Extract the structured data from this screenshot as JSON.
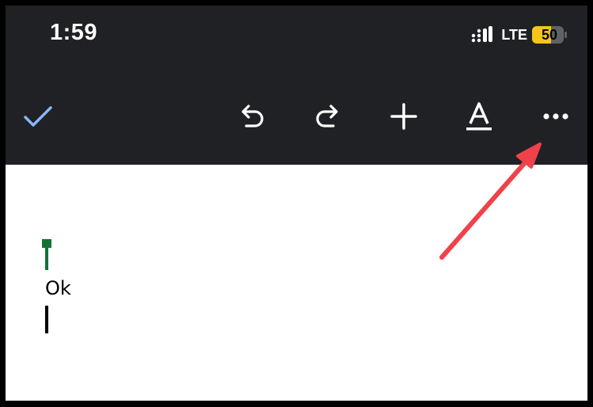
{
  "status_bar": {
    "time": "1:59",
    "network": "LTE",
    "battery": "50"
  },
  "toolbar": {
    "done_icon": "checkmark-icon",
    "undo_icon": "undo-icon",
    "redo_icon": "redo-icon",
    "insert_icon": "plus-icon",
    "format_icon": "text-format-icon",
    "more_icon": "more-horizontal-icon"
  },
  "document": {
    "text": "Ok"
  },
  "colors": {
    "toolbar_bg": "#202124",
    "accent_blue": "#8ab4f8",
    "cursor_green": "#137333",
    "battery_yellow": "#f5c518",
    "annotation_red": "#f0424a"
  }
}
